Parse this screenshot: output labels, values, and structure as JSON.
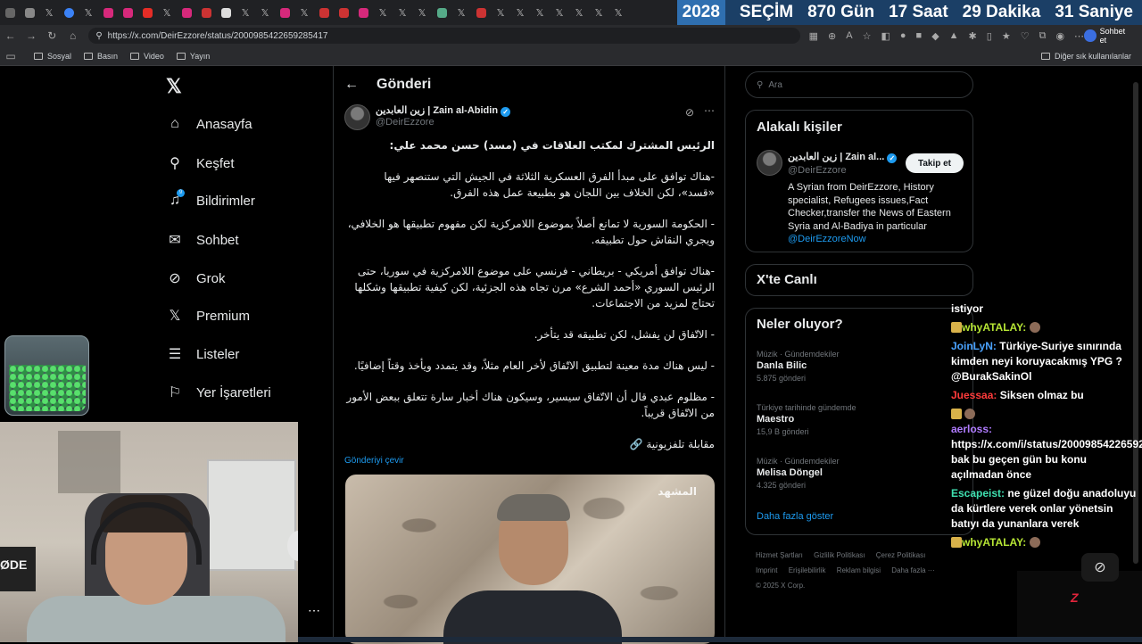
{
  "browser": {
    "url": "https://x.com/DeirEzzore/status/2000985422659285417",
    "chat_button": "Sohbet et",
    "bookmarks": [
      "Sosyal",
      "Basın",
      "Video",
      "Yayın"
    ],
    "other_bookmarks": "Diğer sık kullanılanlar"
  },
  "countdown": {
    "year": "2028",
    "label": "SEÇİM",
    "days": "870 Gün",
    "hours": "17 Saat",
    "minutes": "29 Dakika",
    "seconds": "31 Saniye"
  },
  "nav": {
    "items": [
      {
        "label": "Anasayfa",
        "icon": "home-icon"
      },
      {
        "label": "Keşfet",
        "icon": "search-icon"
      },
      {
        "label": "Bildirimler",
        "icon": "bell-icon"
      },
      {
        "label": "Sohbet",
        "icon": "mail-icon"
      },
      {
        "label": "Grok",
        "icon": "grok-icon"
      },
      {
        "label": "Premium",
        "icon": "x-icon"
      },
      {
        "label": "Listeler",
        "icon": "list-icon"
      },
      {
        "label": "Yer İşaretleri",
        "icon": "bookmark-icon"
      }
    ],
    "notif_badge": "9"
  },
  "main": {
    "title": "Gönderi",
    "author": {
      "name": "زين العابدين | Zain al-Abidin",
      "handle": "@DeirEzzore"
    },
    "tweet": {
      "heading": "الرئيس المشترك لمكتب العلاقات في (مسد) حسن محمد علي:",
      "p1": "-هناك توافق على مبدأ الفرق العسكرية الثلاثة في الجيش التي ستنصهر فيها «قسد»، لكن الخلاف بين اللجان هو بطبيعة عمل هذه الفرق.",
      "p2": "- الحكومة السورية لا تمانع أصلاً بموضوع اللامركزية لكن مفهوم تطبيقها هو الخلافي، ويجري النقاش حول تطبيقه.",
      "p3": "-هناك توافق أمريكي - بريطاني - فرنسي على موضوع اللامركزية في سوريا، حتى الرئيس السوري «أحمد الشرع» مرن تجاه هذه الجزئية، لكن كيفية تطبيقها وشكلها تحتاج لمزيد من الاجتماعات.",
      "p4": "- الاتّفاق لن يفشل، لكن تطبيقه قد يتأخر.",
      "p5": "- ليس هناك مدة معينة لتطبيق الاتّفاق لأخر العام مثلاً، وقد يتمدد ويأخذ وقتاً إضافيًا.",
      "p6": "- مظلوم عبدي قال أن الاتّفاق سيسير، وسيكون هناك أخبار سارة تتعلق ببعض الأمور من الاتّفاق قريباً.",
      "p7": "مقابلة تلفزيونية 🔗"
    },
    "translate": "Gönderiyi çevir",
    "media_channel": "المشهد"
  },
  "sidebar": {
    "search_placeholder": "Ara",
    "related_title": "Alakalı kişiler",
    "related": {
      "name": "زين العابدين | Zain al...",
      "handle": "@DeirEzzore",
      "follow": "Takip et",
      "bio": "A Syrian from DeirEzzore, History specialist, Refugees issues,Fact Checker,transfer the News of Eastern Syria and Al-Badiya in particular",
      "bio_link": "@DeirEzzoreNow"
    },
    "live_title": "X'te Canlı",
    "trends_title": "Neler oluyor?",
    "trends": [
      {
        "category": "Müzik · Gündemdekiler",
        "name": "Danla Bilic",
        "count": "5.875 gönderi"
      },
      {
        "category": "Türkiye tarihinde gündemde",
        "name": "Maestro",
        "count": "15,9 B gönderi"
      },
      {
        "category": "Müzik · Gündemdekiler",
        "name": "Melisa Döngel",
        "count": "4.325 gönderi"
      }
    ],
    "show_more": "Daha fazla göster",
    "footer": [
      "Hizmet Şartları",
      "Gizlilik Politikası",
      "Çerez Politikası",
      "Imprint",
      "Erişilebilirlik",
      "Reklam bilgisi",
      "Daha fazla ···",
      "© 2025 X Corp."
    ]
  },
  "chat": {
    "messages": [
      {
        "user": "",
        "text": "istiyor",
        "color": "#ffffff"
      },
      {
        "user": "whyATALAY:",
        "text": "",
        "color": "#b7e635"
      },
      {
        "user": "JoinLyN:",
        "text": "Türkiye-Suriye sınırında kimden neyi koruyacakmış YPG ? @BurakSakinOl",
        "color": "#4aa3ff"
      },
      {
        "user": "Juessaa:",
        "text": "Siksen olmaz bu",
        "color": "#ff3b3b"
      },
      {
        "user": "aerloss:",
        "text": "https://x.com/i/status/2000985422659285417 bak bu geçen gün bu konu açılmadan önce",
        "color": "#b07cff"
      },
      {
        "user": "Escapeist:",
        "text": "ne güzel doğu anadoluyu da kürtlere verek onlar yönetsin batıyı da yunanlara verek",
        "color": "#3fe0b0"
      },
      {
        "user": "whyATALAY:",
        "text": "",
        "color": "#b7e635"
      }
    ]
  },
  "webcam": {
    "mic_label": "ØDE"
  }
}
